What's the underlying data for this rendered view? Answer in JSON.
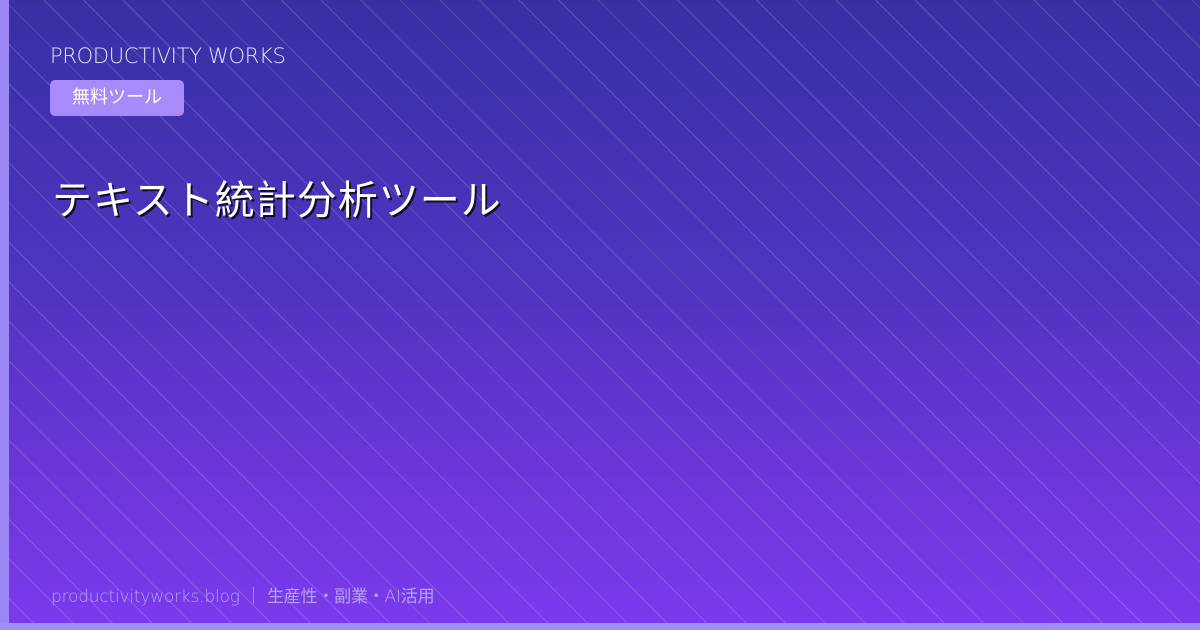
{
  "brand": "PRODUCTIVITY WORKS",
  "badge": "無料ツール",
  "title": "テキスト統計分析ツール",
  "footer": "productivityworks.blog ｜ 生産性・副業・AI活用",
  "colors": {
    "background_top": "#3730a3",
    "background_bottom": "#7c3aed",
    "accent_bar": "#9b87f5",
    "badge": "#a78bfa"
  }
}
